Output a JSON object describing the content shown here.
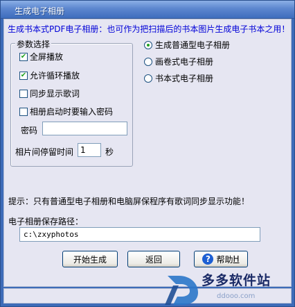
{
  "window": {
    "title": "生成电子相册"
  },
  "headline": "生成书本式PDF电子相册：也可作为把扫描后的书本图片生成电子书本之用！",
  "options_group": {
    "label": "参数选择",
    "checkboxes": [
      {
        "label": "全屏播放",
        "checked": true
      },
      {
        "label": "允许循环播放",
        "checked": true
      },
      {
        "label": "同步显示歌词",
        "checked": false
      },
      {
        "label": "相册启动时要输入密码",
        "checked": false
      }
    ],
    "password_label": "密码",
    "password_value": "",
    "stay_label": "相片间停留时间",
    "stay_value": "1",
    "stay_unit": "秒"
  },
  "album_types": [
    {
      "label": "生成普通型电子相册",
      "selected": true
    },
    {
      "label": "画卷式电子相册",
      "selected": false
    },
    {
      "label": "书本式电子相册",
      "selected": false
    }
  ],
  "hint": "提示：只有普通型电子相册和电脑屏保程序有歌词同步显示功能！",
  "path": {
    "label": "电子相册保存路径：",
    "value": "c:\\zxyphotos"
  },
  "buttons": {
    "start": "开始生成",
    "back": "返回",
    "help": "帮助",
    "help_accel": "H"
  },
  "watermark": {
    "text": "多多软件站",
    "url": "ddooo.com"
  },
  "colors": {
    "headline": "#0000d8",
    "title_bar": "#4f7ac6",
    "check_mark": "#21a121"
  },
  "icons": {
    "help": "question-mark-icon",
    "logo": "ddooo-logo-icon"
  }
}
